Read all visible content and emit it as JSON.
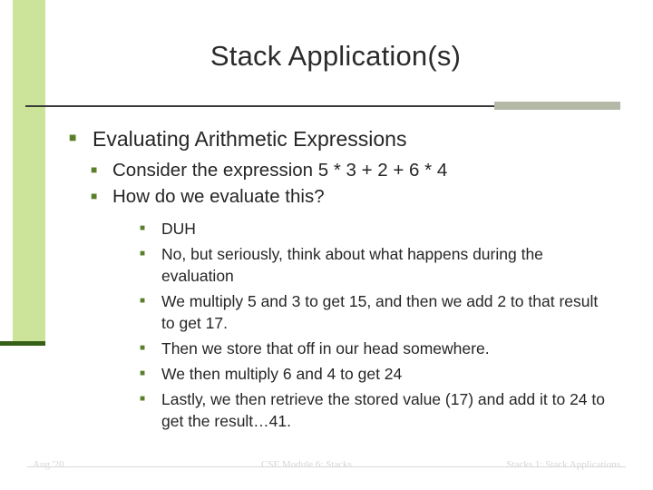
{
  "slide": {
    "title": "Stack Application(s)",
    "bullet_glyph": "■",
    "accent_green": "#cce499",
    "accent_dark_green": "#365f18",
    "rule_gray": "#b4b9a7",
    "level1": [
      {
        "text": "Evaluating Arithmetic Expressions",
        "level2": [
          {
            "text": "Consider the expression 5 * 3 + 2 + 6 * 4"
          },
          {
            "text": "How do we evaluate this?",
            "level3": [
              {
                "text": "DUH"
              },
              {
                "text": "No, but seriously, think about what happens during the evaluation"
              },
              {
                "text": "We multiply 5 and 3 to get 15, and then we add 2 to that result to get 17."
              },
              {
                "text": "Then we store that off in our head somewhere."
              },
              {
                "text": "We then multiply 6 and 4 to get 24"
              },
              {
                "text": "Lastly, we then retrieve the stored value (17) and add it to 24 to get the result…41."
              }
            ]
          }
        ]
      }
    ]
  },
  "footer": {
    "left": "Aug '20",
    "center": "CSE Module 6: Stacks",
    "right": "Stacks 1: Stack Applications"
  }
}
